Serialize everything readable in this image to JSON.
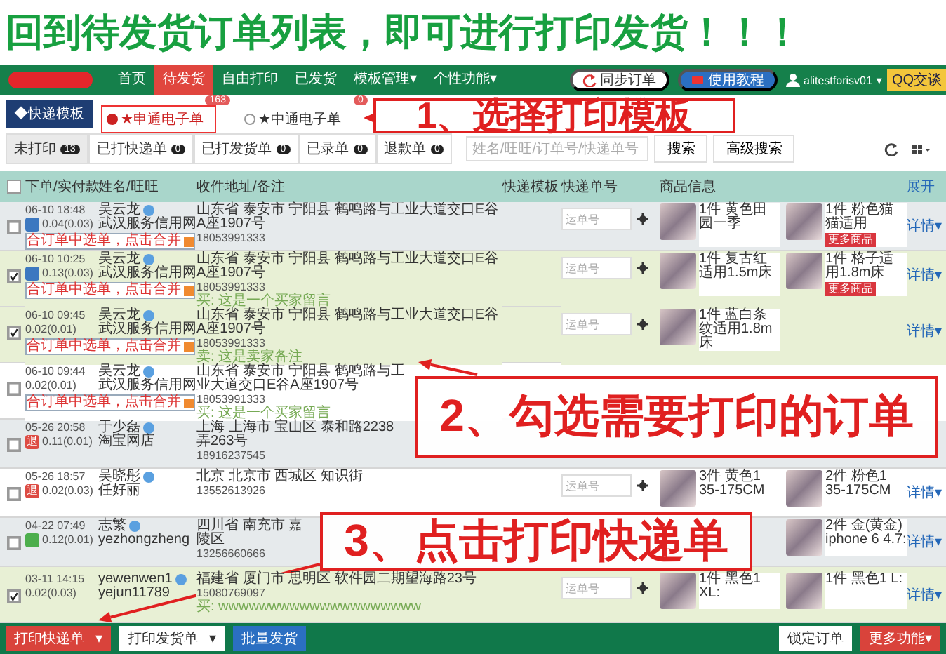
{
  "banner": {
    "text": "回到待发货订单列表，即可进行打印发货！！！"
  },
  "nav": {
    "items": [
      {
        "label": "首页",
        "selected": false
      },
      {
        "label": "待发货",
        "selected": true
      },
      {
        "label": "自由打印",
        "selected": false
      },
      {
        "label": "已发货",
        "selected": false
      },
      {
        "label": "模板管理▾",
        "selected": false
      },
      {
        "label": "个性功能▾",
        "selected": false
      }
    ],
    "sync_button": "同步订单",
    "help_button": "使用教程",
    "user": "alitestforisv01",
    "user_caret": "▾",
    "chat_button": "QQ交谈"
  },
  "templates": {
    "button": "◆快递模板",
    "items": [
      {
        "label": "★申通电子单",
        "count": "163",
        "selected": true
      },
      {
        "label": "★中通电子单",
        "count": "0",
        "selected": false
      }
    ]
  },
  "filters": {
    "items": [
      {
        "label": "未打印",
        "count": "13",
        "selected": true
      },
      {
        "label": "已打快递单",
        "count": "0",
        "selected": false
      },
      {
        "label": "已打发货单",
        "count": "0",
        "selected": false
      },
      {
        "label": "已录单",
        "count": "0",
        "selected": false
      },
      {
        "label": "退款单",
        "count": "0",
        "selected": false
      }
    ],
    "search_placeholder": "姓名/旺旺/订单号/快递单号",
    "search_button": "搜索",
    "advanced_button": "高级搜索"
  },
  "table": {
    "select_all": false,
    "columns": [
      "下单/实付款",
      "姓名/旺旺",
      "收件地址/备注",
      "快递模板",
      "快递单号",
      "商品信息"
    ],
    "expand": "展开",
    "rows": [
      {
        "checked": false,
        "date": "06-10 18:48",
        "badge": {
          "kind": "blue"
        },
        "amount": "0.04(0.03)",
        "memo": "合订单中选单，点击合并",
        "name": "吴云龙",
        "shop": "武汉服务信用网",
        "address": "山东省 泰安市 宁阳县 鹤鸣路与工业大道交口E谷A座1907号",
        "phone": "18053991333",
        "covered": false,
        "express_covered": false,
        "express_placeholder": "运单号",
        "products": [
          {
            "text": "1件 黄色田园一季",
            "covered": false
          },
          {
            "text": "1件 粉色猫猫适用",
            "covered": false
          }
        ],
        "more": "更多商品",
        "detail": "详情▾"
      },
      {
        "checked": true,
        "date": "06-10 10:25",
        "badge": {
          "kind": "blue"
        },
        "amount": "0.13(0.03)",
        "memo": "合订单中选单，点击合并",
        "name": "吴云龙",
        "shop": "武汉服务信用网",
        "address": "山东省 泰安市 宁阳县 鹤鸣路与工业大道交口E谷A座1907号",
        "phone": "18053991333",
        "remark": "买: 这是一个买家留言",
        "covered": false,
        "express_covered": false,
        "express_placeholder": "运单号",
        "products": [
          {
            "text": "1件 复古红适用1.5m床",
            "covered": false
          },
          {
            "text": "1件 格子适用1.8m床",
            "covered": false
          }
        ],
        "more": "更多商品",
        "detail": "详情▾"
      },
      {
        "checked": true,
        "date": "06-10 09:45",
        "amount": "0.02(0.01)",
        "memo": "合订单中选单，点击合并",
        "name": "吴云龙",
        "shop": "武汉服务信用网",
        "address": "山东省 泰安市 宁阳县 鹤鸣路与工业大道交口E谷A座1907号",
        "phone": "18053991333",
        "remark": "卖: 这是卖家备注",
        "covered": false,
        "express_covered": false,
        "express_placeholder": "运单号",
        "products": [
          {
            "text": "1件 蓝白条纹适用1.8m床",
            "covered": false
          }
        ],
        "detail": "详情▾"
      },
      {
        "checked": false,
        "date": "06-10 09:44",
        "amount": "0.02(0.01)",
        "memo": "合订单中选单，点击合并",
        "name": "吴云龙",
        "shop": "武汉服务信用网",
        "address": "山东省 泰安市 宁阳县 鹤鸣路与工业大道交口E谷A座1907号",
        "phone": "18053991333",
        "remark": "买: 这是一个买家留言",
        "covered": true
      },
      {
        "checked": false,
        "date": "05-26 20:58",
        "badge": {
          "kind": "red",
          "text": "退"
        },
        "amount": "0.11(0.01)",
        "name": "于少磊",
        "shop": "淘宝网店",
        "address": "上海 上海市 宝山区 泰和路2238弄263号",
        "phone": "18916237545",
        "covered": true
      },
      {
        "checked": false,
        "date": "05-26 18:57",
        "badge": {
          "kind": "red",
          "text": "退"
        },
        "amount": "0.02(0.03)",
        "name": "吴晓彤",
        "shop": "任好丽",
        "address": "北京 北京市 西城区 知识街",
        "phone": "13552613926",
        "covered": false,
        "express_covered": false,
        "express_placeholder": "运单号",
        "products": [
          {
            "text": "3件 黄色1 35-175CM",
            "covered": false
          },
          {
            "text": "2件 粉色1 35-175CM",
            "covered": false
          }
        ],
        "detail": "详情▾"
      },
      {
        "checked": false,
        "date": "04-22 07:49",
        "badge": {
          "kind": "green"
        },
        "amount": "0.12(0.01)",
        "name": "志繁",
        "shop": "yezhongzheng",
        "address": "四川省 南充市 嘉陵区",
        "phone": "13256660666",
        "covered": false,
        "express_covered": true,
        "products": [
          {
            "text": "2件 金(黄金) iphone 6 4.7:",
            "covered": false
          }
        ],
        "detail": "详情▾"
      },
      {
        "checked": true,
        "date": "03-11 14:15",
        "amount": "0.02(0.03)",
        "name": "yewenwen1",
        "shop": "yejun11789",
        "address": "福建省 厦门市 思明区 软件园二期望海路23号",
        "phone": "15080769097",
        "remark": "买: wwwwwwwwwwwwwwwwwwww",
        "covered": false,
        "express_covered": false,
        "express_placeholder": "运单号",
        "products": [
          {
            "text": "1件 黑色1 XL:",
            "covered": false
          },
          {
            "text": "1件 黑色1 L:",
            "covered": false
          }
        ],
        "detail": "详情▾"
      }
    ]
  },
  "bottom_bar": {
    "left": [
      {
        "label": "打印快递单",
        "kind": "red",
        "caret": "▾"
      },
      {
        "label": "打印发货单",
        "kind": "white",
        "caret": "▾"
      },
      {
        "label": "批量发货",
        "kind": "blue"
      }
    ],
    "right": [
      {
        "label": "锁定订单",
        "kind": "white"
      },
      {
        "label": "更多功能▾",
        "kind": "red"
      }
    ]
  },
  "annotations": [
    {
      "text": "1、选择打印模板",
      "kind": "step1"
    },
    {
      "text": "2、勾选需要打印的订单",
      "kind": "step2"
    },
    {
      "text": "3、点击打印快递单",
      "kind": "step3"
    }
  ]
}
